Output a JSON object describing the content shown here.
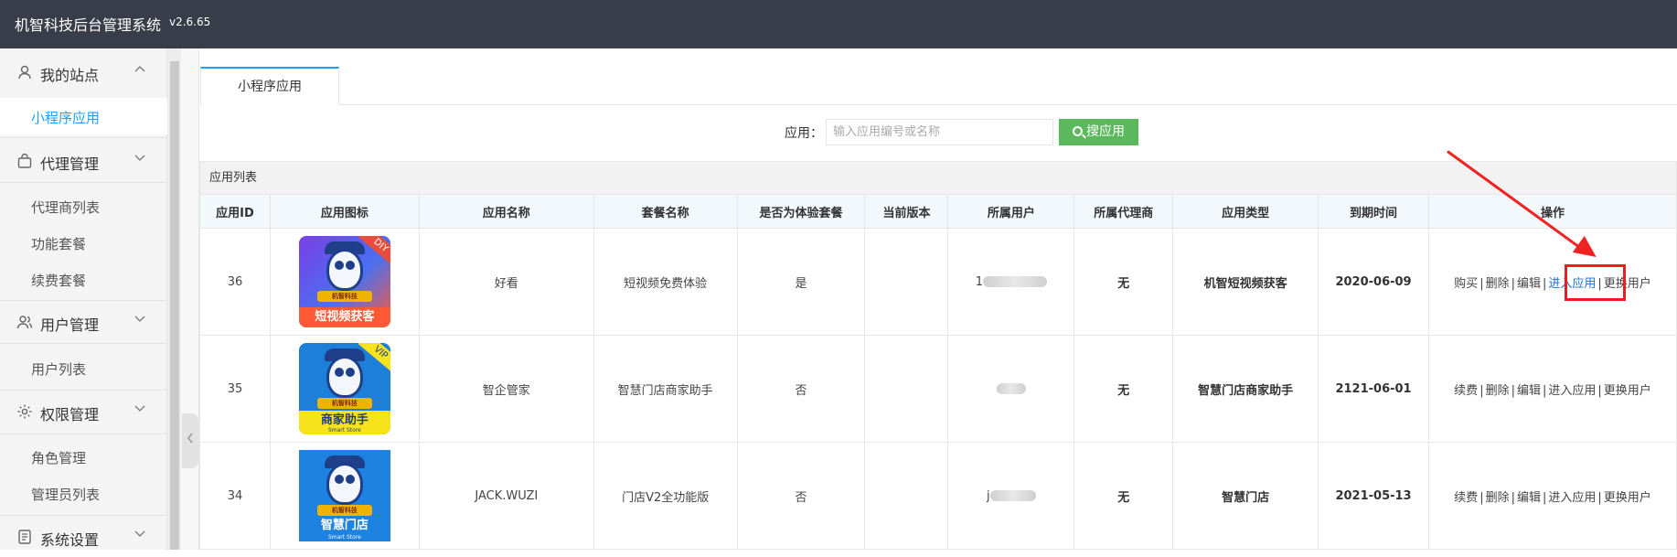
{
  "header": {
    "title": "机智科技后台管理系统",
    "version": "v2.6.65"
  },
  "sidebar": {
    "groups": [
      {
        "label": "我的站点",
        "icon": "user-icon",
        "expanded": true,
        "items": [
          {
            "label": "小程序应用",
            "active": true
          }
        ]
      },
      {
        "label": "代理管理",
        "icon": "bag-icon",
        "expanded": true,
        "items": [
          {
            "label": "代理商列表"
          },
          {
            "label": "功能套餐"
          },
          {
            "label": "续费套餐"
          }
        ]
      },
      {
        "label": "用户管理",
        "icon": "users-icon",
        "expanded": true,
        "items": [
          {
            "label": "用户列表"
          }
        ]
      },
      {
        "label": "权限管理",
        "icon": "gear-icon",
        "expanded": true,
        "items": [
          {
            "label": "角色管理"
          },
          {
            "label": "管理员列表"
          }
        ]
      },
      {
        "label": "系统设置",
        "icon": "document-icon",
        "expanded": false,
        "items": []
      }
    ]
  },
  "tabs": [
    {
      "label": "小程序应用",
      "active": true
    }
  ],
  "search": {
    "label": "应用：",
    "placeholder": "输入应用编号或名称",
    "value": "",
    "button_label": "搜应用"
  },
  "panel": {
    "title": "应用列表"
  },
  "table": {
    "columns": [
      "应用ID",
      "应用图标",
      "应用名称",
      "套餐名称",
      "是否为体验套餐",
      "当前版本",
      "所属用户",
      "所属代理商",
      "应用类型",
      "到期时间",
      "操作"
    ],
    "rows": [
      {
        "id": "36",
        "icon_caption": "短视频获客",
        "icon_badge": "DIY",
        "icon_ribbon": "机智科技",
        "name": "好看",
        "package": "短视频免费体验",
        "is_trial": "是",
        "version": "",
        "user": "1",
        "agent": "无",
        "type": "机智短视频获客",
        "expires": "2020-06-09",
        "actions": [
          "购买",
          "删除",
          "编辑",
          "进入应用",
          "更换用户"
        ]
      },
      {
        "id": "35",
        "icon_caption": "商家助手",
        "icon_badge": "VIP",
        "icon_ribbon": "机智科技",
        "icon_sub": "Smart Store",
        "name": "智企管家",
        "package": "智慧门店商家助手",
        "is_trial": "否",
        "version": "",
        "user": "",
        "agent": "无",
        "type": "智慧门店商家助手",
        "expires": "2121-06-01",
        "actions": [
          "续费",
          "删除",
          "编辑",
          "进入应用",
          "更换用户"
        ]
      },
      {
        "id": "34",
        "icon_caption": "智慧门店",
        "icon_badge": "",
        "icon_ribbon": "机智科技",
        "icon_sub": "Smart Store",
        "name": "JACK.WUZI",
        "package": "门店V2全功能版",
        "is_trial": "否",
        "version": "",
        "user": "j",
        "agent": "无",
        "type": "智慧门店",
        "expires": "2021-05-13",
        "actions": [
          "续费",
          "删除",
          "编辑",
          "进入应用",
          "更换用户"
        ]
      }
    ]
  },
  "colors": {
    "topbar": "#393d49",
    "accent": "#1e9fff",
    "search_button": "#5cb85c",
    "annotation": "#e81f1f"
  }
}
